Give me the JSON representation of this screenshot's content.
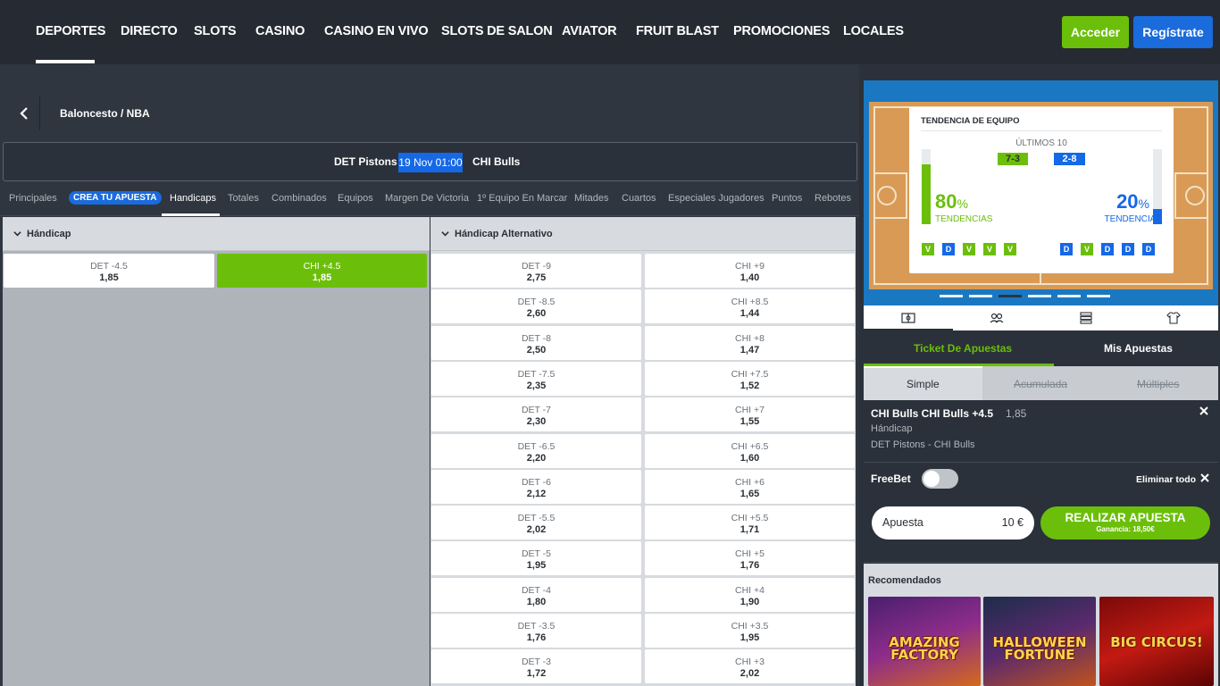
{
  "nav": {
    "items": [
      "DEPORTES",
      "DIRECTO",
      "SLOTS",
      "CASINO",
      "CASINO EN VIVO",
      "SLOTS DE SALON",
      "AVIATOR",
      "FRUIT BLAST",
      "PROMOCIONES",
      "LOCALES"
    ],
    "login": "Acceder",
    "register": "Regístrate"
  },
  "breadcrumb": "Baloncesto / NBA",
  "event": {
    "home": "DET Pistons",
    "time": "19 Nov 01:00",
    "away": "CHI Bulls"
  },
  "tabs": [
    "Principales",
    "CREA TU APUESTA",
    "Handicaps",
    "Totales",
    "Combinados",
    "Equipos",
    "Margen De Victoria",
    "1º Equipo En Marcar",
    "Mitades",
    "Cuartos",
    "Especiales Jugadores",
    "Puntos",
    "Rebotes"
  ],
  "markets": {
    "handicap": {
      "title": "Hándicap",
      "home": {
        "label": "DET -4.5",
        "odds": "1,85"
      },
      "away": {
        "label": "CHI +4.5",
        "odds": "1,85"
      }
    },
    "alternative": {
      "title": "Hándicap Alternativo",
      "rows": [
        {
          "home": "DET -9",
          "home_odds": "2,75",
          "away": "CHI +9",
          "away_odds": "1,40"
        },
        {
          "home": "DET -8.5",
          "home_odds": "2,60",
          "away": "CHI +8.5",
          "away_odds": "1,44"
        },
        {
          "home": "DET -8",
          "home_odds": "2,50",
          "away": "CHI +8",
          "away_odds": "1,47"
        },
        {
          "home": "DET -7.5",
          "home_odds": "2,35",
          "away": "CHI +7.5",
          "away_odds": "1,52"
        },
        {
          "home": "DET -7",
          "home_odds": "2,30",
          "away": "CHI +7",
          "away_odds": "1,55"
        },
        {
          "home": "DET -6.5",
          "home_odds": "2,20",
          "away": "CHI +6.5",
          "away_odds": "1,60"
        },
        {
          "home": "DET -6",
          "home_odds": "2,12",
          "away": "CHI +6",
          "away_odds": "1,65"
        },
        {
          "home": "DET -5.5",
          "home_odds": "2,02",
          "away": "CHI +5.5",
          "away_odds": "1,71"
        },
        {
          "home": "DET -5",
          "home_odds": "1,95",
          "away": "CHI +5",
          "away_odds": "1,76"
        },
        {
          "home": "DET -4",
          "home_odds": "1,80",
          "away": "CHI +4",
          "away_odds": "1,90"
        },
        {
          "home": "DET -3.5",
          "home_odds": "1,76",
          "away": "CHI +3.5",
          "away_odds": "1,95"
        },
        {
          "home": "DET -3",
          "home_odds": "1,72",
          "away": "CHI +3",
          "away_odds": "2,02"
        }
      ]
    }
  },
  "stats": {
    "title": "TENDENCIA DE EQUIPO",
    "subtitle": "ÚLTIMOS 10",
    "home_record": "7-3",
    "away_record": "2-8",
    "home_pct": "80",
    "away_pct": "20",
    "home_pct_value": 80,
    "away_pct_value": 20,
    "pct_sign": "%",
    "tend_label": "TENDENCIAS",
    "home_form": [
      "V",
      "D",
      "V",
      "V",
      "V"
    ],
    "away_form": [
      "D",
      "V",
      "D",
      "D",
      "D"
    ]
  },
  "ticket": {
    "tab_ticket": "Ticket De Apuestas",
    "tab_my_bets": "Mis Apuestas",
    "mode_simple": "Simple",
    "mode_acc": "Acumulada",
    "mode_multi": "Múltiples",
    "selection_title": "CHI Bulls CHI Bulls +4.5",
    "selection_odds": "1,85",
    "selection_market": "Hándicap",
    "selection_event": "DET Pistons - CHI Bulls",
    "freebet": "FreeBet",
    "clear_all": "Eliminar todo",
    "stake_label": "Apuesta",
    "stake_value": "10 €",
    "place_bet": "REALIZAR APUESTA",
    "winnings": "Ganancia: 18,50€"
  },
  "recommended": {
    "title": "Recomendados",
    "games": [
      "AMAZING FACTORY",
      "HALLOWEEN FORTUNE",
      "BIG CIRCUS!"
    ]
  },
  "colors": {
    "accent_green": "#6bbf0a",
    "accent_blue": "#1a6bdc",
    "nav_bg": "#262b33"
  }
}
